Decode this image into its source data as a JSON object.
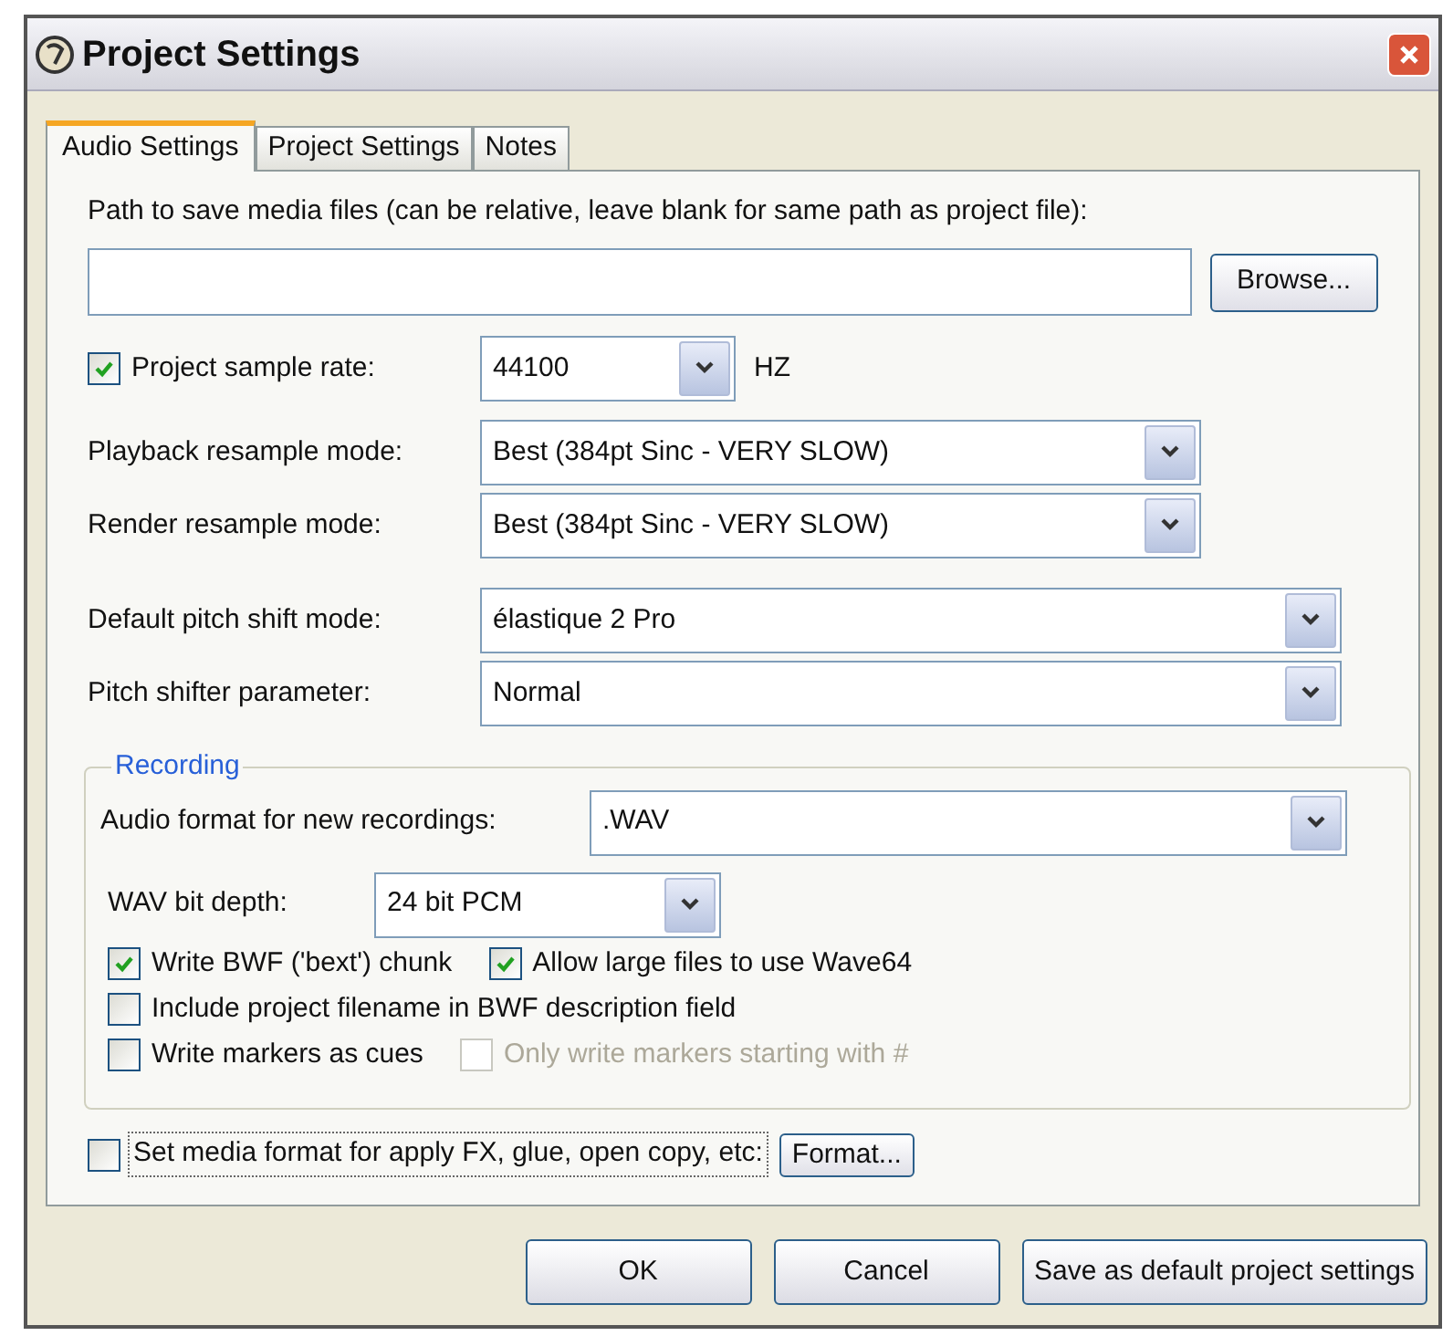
{
  "window": {
    "title": "Project Settings"
  },
  "tabs": [
    {
      "label": "Audio Settings",
      "selected": true
    },
    {
      "label": "Project Settings",
      "selected": false
    },
    {
      "label": "Notes",
      "selected": false
    }
  ],
  "path": {
    "label": "Path to save media files (can be relative, leave blank for same path as project file):",
    "button": "Browse..."
  },
  "sample_rate": {
    "label": "Project sample rate:",
    "checked": true,
    "value": "44100",
    "unit": "HZ"
  },
  "selects": [
    {
      "label": "Playback resample mode:",
      "value": "Best (384pt Sinc - VERY SLOW)"
    },
    {
      "label": "Render resample mode:",
      "value": "Best (384pt Sinc - VERY SLOW)"
    },
    {
      "label": "Default pitch shift mode:",
      "value": "élastique 2 Pro"
    },
    {
      "label": "Pitch shifter parameter:",
      "value": "Normal"
    }
  ],
  "recording": {
    "title": "Recording",
    "format": {
      "label": "Audio format for new recordings:",
      "value": ".WAV"
    },
    "bit_depth": {
      "label": "WAV bit depth:",
      "value": "24 bit PCM"
    },
    "option_rows": [
      [
        {
          "label": "Write BWF ('bext') chunk",
          "checked": true,
          "disabled": false
        },
        {
          "label": "Allow large files to use Wave64",
          "checked": true,
          "disabled": false
        }
      ],
      [
        {
          "label": "Include project filename in BWF description field",
          "checked": false,
          "disabled": false
        }
      ],
      [
        {
          "label": "Write markers as cues",
          "checked": false,
          "disabled": false
        },
        {
          "label": "Only write markers starting with #",
          "checked": false,
          "disabled": true
        }
      ]
    ]
  },
  "media_format": {
    "label": "Set media format for apply FX, glue, open copy, etc:",
    "checked": false,
    "button": "Format..."
  },
  "buttons": [
    "OK",
    "Cancel",
    "Save as default project settings"
  ]
}
